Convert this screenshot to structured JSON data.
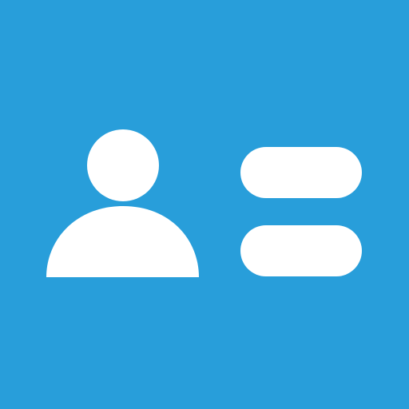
{
  "icon": {
    "name": "user-list-icon",
    "background_color": "#289EDA",
    "foreground_color": "#FFFFFF",
    "parts": {
      "avatar": "person-icon",
      "lines": [
        "line-bar-top",
        "line-bar-bottom"
      ]
    }
  }
}
